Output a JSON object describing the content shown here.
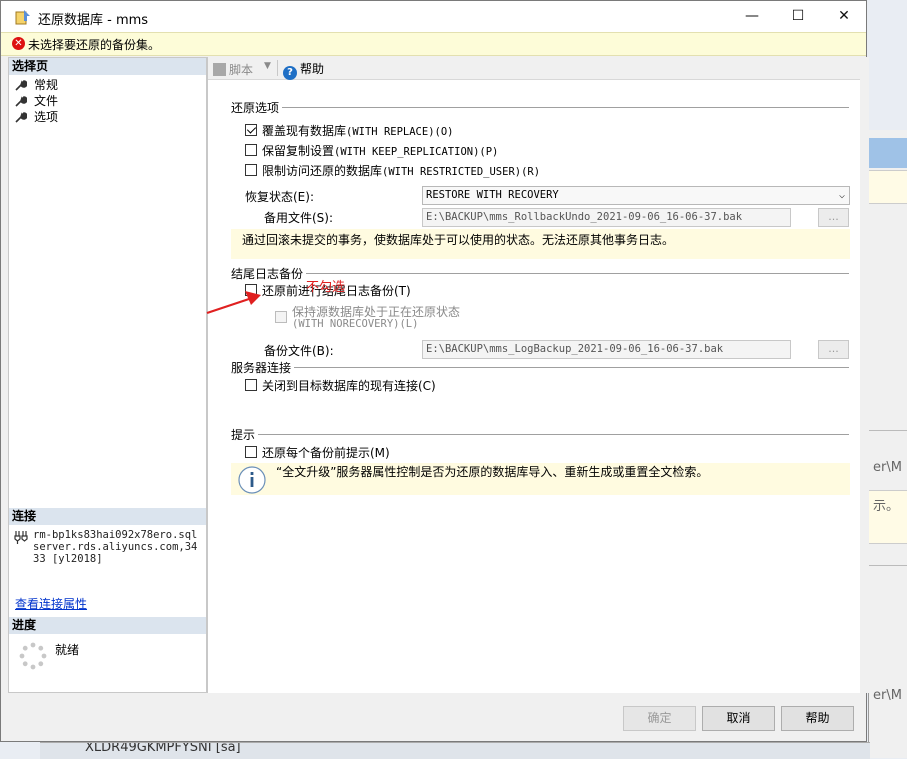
{
  "window": {
    "title": "还原数据库 - mms",
    "minimize": "—",
    "maximize": "☐",
    "close": "✕"
  },
  "error_bar": {
    "icon": "error-icon",
    "text": "未选择要还原的备份集。"
  },
  "left_panel": {
    "select_page_header": "选择页",
    "pages": [
      {
        "label": "常规",
        "icon": "wrench-icon"
      },
      {
        "label": "文件",
        "icon": "wrench-icon"
      },
      {
        "label": "选项",
        "icon": "wrench-icon"
      }
    ],
    "connection_header": "连接",
    "connection_text": "rm-bp1ks83hai092x78ero.sqlserver.rds.aliyuncs.com,3433 [yl2018]",
    "connection_link": "查看连接属性",
    "progress_header": "进度",
    "progress_status": "就绪"
  },
  "toolbar": {
    "script_label": "脚本",
    "help_label": "帮助"
  },
  "restore_options": {
    "group_title": "还原选项",
    "overwrite": {
      "label_cn": "覆盖现有数据库",
      "label_en": "(WITH REPLACE)(O)",
      "checked": true
    },
    "keep_replication": {
      "label_cn": "保留复制设置",
      "label_en": "(WITH KEEP_REPLICATION)(P)",
      "checked": false
    },
    "restricted_user": {
      "label_cn": "限制访问还原的数据库",
      "label_en": "(WITH RESTRICTED_USER)(R)",
      "checked": false
    },
    "recovery_state_label": "恢复状态(E):",
    "recovery_state_value": "RESTORE WITH RECOVERY",
    "standby_file_label": "备用文件(S):",
    "standby_file_value": "E:\\BACKUP\\mms_RollbackUndo_2021-09-06_16-06-37.bak",
    "browse_label": "...",
    "recovery_note": "通过回滚未提交的事务，使数据库处于可以使用的状态。无法还原其他事务日志。"
  },
  "tail_log": {
    "group_title": "结尾日志备份",
    "take_tail_log": {
      "label": "还原前进行结尾日志备份(T)",
      "checked": false
    },
    "norecovery": {
      "label_cn": "保持源数据库处于正在还原状态",
      "label_en": "(WITH NORECOVERY)(L)",
      "checked": false
    },
    "backup_file_label": "备份文件(B):",
    "backup_file_value": "E:\\BACKUP\\mms_LogBackup_2021-09-06_16-06-37.bak",
    "browse_label": "..."
  },
  "server_connections": {
    "group_title": "服务器连接",
    "close_existing": {
      "label": "关闭到目标数据库的现有连接(C)",
      "checked": false
    }
  },
  "prompt": {
    "group_title": "提示",
    "prompt_before": {
      "label": "还原每个备份前提示(M)",
      "checked": false
    },
    "info_note": "“全文升级”服务器属性控制是否为还原的数据库导入、重新生成或重置全文检索。"
  },
  "annotation": {
    "text": "不勾选",
    "color": "#e02020"
  },
  "buttons": {
    "ok": "确定",
    "cancel": "取消",
    "help": "帮助"
  },
  "background": {
    "strip_text": "XLDR49GKMPFYSNI [sa]",
    "right_frag_1": "er\\M",
    "right_frag_2": "示。",
    "right_frag_3": "er\\M"
  }
}
